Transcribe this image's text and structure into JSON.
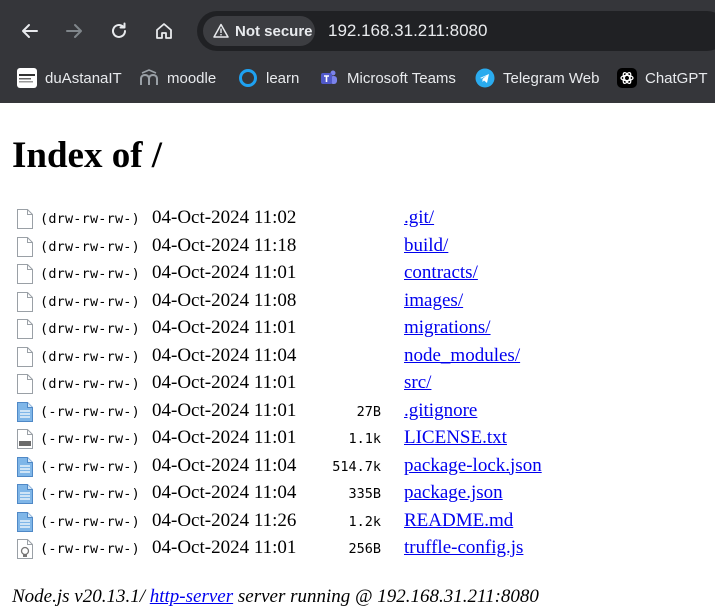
{
  "browser": {
    "security_label": "Not secure",
    "url": "192.168.31.211:8080",
    "bookmarks": [
      {
        "label": "duAstanaIT",
        "icon": "duastanait-icon"
      },
      {
        "label": "moodle",
        "icon": "moodle-icon"
      },
      {
        "label": "learn",
        "icon": "learn-icon"
      },
      {
        "label": "Microsoft Teams",
        "icon": "teams-icon"
      },
      {
        "label": "Telegram Web",
        "icon": "telegram-icon"
      },
      {
        "label": "ChatGPT",
        "icon": "chatgpt-icon"
      }
    ]
  },
  "page": {
    "heading": "Index of /",
    "rows": [
      {
        "perm": "(drw-rw-rw-)",
        "date": "04-Oct-2024 11:02",
        "size": "",
        "name": ".git/",
        "icon": "folder-file-icon"
      },
      {
        "perm": "(drw-rw-rw-)",
        "date": "04-Oct-2024 11:18",
        "size": "",
        "name": "build/",
        "icon": "folder-file-icon"
      },
      {
        "perm": "(drw-rw-rw-)",
        "date": "04-Oct-2024 11:01",
        "size": "",
        "name": "contracts/",
        "icon": "folder-file-icon"
      },
      {
        "perm": "(drw-rw-rw-)",
        "date": "04-Oct-2024 11:08",
        "size": "",
        "name": "images/",
        "icon": "folder-file-icon"
      },
      {
        "perm": "(drw-rw-rw-)",
        "date": "04-Oct-2024 11:01",
        "size": "",
        "name": "migrations/",
        "icon": "folder-file-icon"
      },
      {
        "perm": "(drw-rw-rw-)",
        "date": "04-Oct-2024 11:04",
        "size": "",
        "name": "node_modules/",
        "icon": "folder-file-icon"
      },
      {
        "perm": "(drw-rw-rw-)",
        "date": "04-Oct-2024 11:01",
        "size": "",
        "name": "src/",
        "icon": "folder-file-icon"
      },
      {
        "perm": "(-rw-rw-rw-)",
        "date": "04-Oct-2024 11:01",
        "size": "27B",
        "name": ".gitignore",
        "icon": "text-doc-icon"
      },
      {
        "perm": "(-rw-rw-rw-)",
        "date": "04-Oct-2024 11:01",
        "size": "1.1k",
        "name": "LICENSE.txt",
        "icon": "txt-file-icon"
      },
      {
        "perm": "(-rw-rw-rw-)",
        "date": "04-Oct-2024 11:04",
        "size": "514.7k",
        "name": "package-lock.json",
        "icon": "text-doc-icon"
      },
      {
        "perm": "(-rw-rw-rw-)",
        "date": "04-Oct-2024 11:04",
        "size": "335B",
        "name": "package.json",
        "icon": "text-doc-icon"
      },
      {
        "perm": "(-rw-rw-rw-)",
        "date": "04-Oct-2024 11:26",
        "size": "1.2k",
        "name": "README.md",
        "icon": "text-doc-icon"
      },
      {
        "perm": "(-rw-rw-rw-)",
        "date": "04-Oct-2024 11:01",
        "size": "256B",
        "name": "truffle-config.js",
        "icon": "js-file-icon"
      }
    ],
    "footer": {
      "prefix": "Node.js v20.13.1/ ",
      "link": "http-server",
      "suffix": " server running @ 192.168.31.211:8080"
    }
  }
}
